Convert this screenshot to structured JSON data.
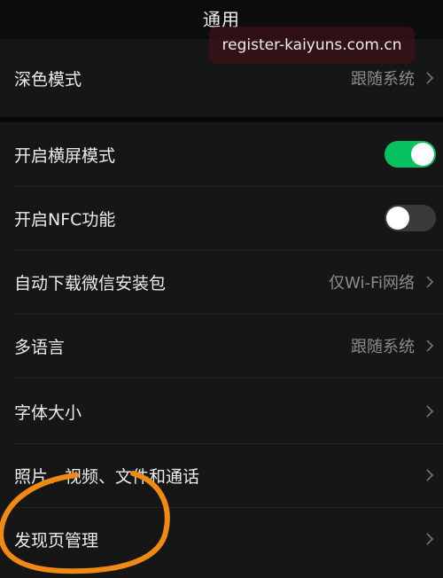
{
  "header": {
    "title": "通用"
  },
  "watermark": {
    "text": "register-kaiyuns.com.cn"
  },
  "rows": {
    "dark_mode": {
      "label": "深色模式",
      "value": "跟随系统"
    },
    "landscape": {
      "label": "开启横屏模式",
      "state": "on"
    },
    "nfc": {
      "label": "开启NFC功能",
      "state": "off"
    },
    "auto_download": {
      "label": "自动下载微信安装包",
      "value": "仅Wi-Fi网络"
    },
    "language": {
      "label": "多语言",
      "value": "跟随系统"
    },
    "font_size": {
      "label": "字体大小"
    },
    "media": {
      "label": "照片、视频、文件和通话"
    },
    "discover": {
      "label": "发现页管理"
    }
  },
  "colors": {
    "toggle_on": "#07c160",
    "toggle_off": "#3a3a3c",
    "annotation": "#f08a12"
  }
}
